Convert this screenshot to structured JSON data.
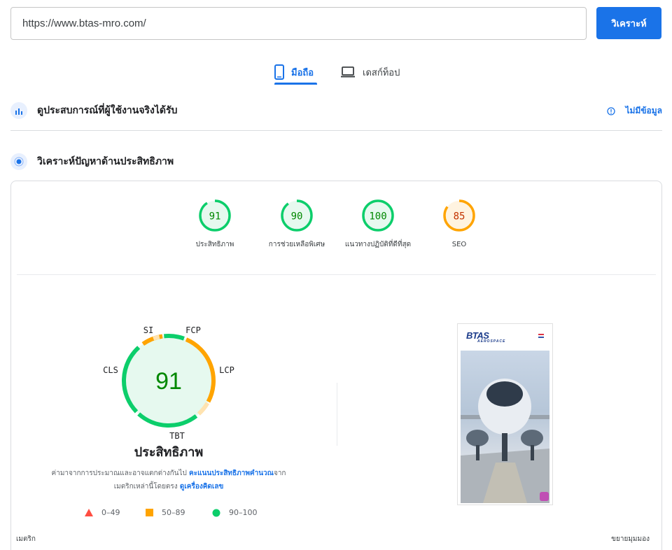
{
  "search": {
    "url": "https://www.btas-mro.com/",
    "button_label": "วิเคราะห์"
  },
  "tabs": [
    {
      "label": "มือถือ",
      "active": true
    },
    {
      "label": "เดสก์ท็อป",
      "active": false
    }
  ],
  "field_data": {
    "title": "ดูประสบการณ์ที่ผู้ใช้งานจริงได้รับ",
    "status_label": "ไม่มีข้อมูล"
  },
  "lab_data": {
    "title": "วิเคราะห์ปัญหาด้านประสิทธิภาพ"
  },
  "scores": [
    {
      "label": "ประสิทธิภาพ",
      "value": "91",
      "color": "#0cce6b",
      "text_color": "#008800"
    },
    {
      "label": "การช่วยเหลือพิเศษ",
      "value": "90",
      "color": "#0cce6b",
      "text_color": "#008800"
    },
    {
      "label": "แนวทางปฏิบัติที่ดีที่สุด",
      "value": "100",
      "color": "#0cce6b",
      "text_color": "#008800"
    },
    {
      "label": "SEO",
      "value": "85",
      "color": "#ffa400",
      "text_color": "#c33300"
    }
  ],
  "performance": {
    "score": "91",
    "title": "ประสิทธิภาพ",
    "metric_labels": {
      "si": "SI",
      "fcp": "FCP",
      "lcp": "LCP",
      "tbt": "TBT",
      "cls": "CLS"
    },
    "note_text": "ค่ามาจากการประมาณและอาจแตกต่างกันไป",
    "note_link1": "คะแนนประสิทธิภาพคำนวณ",
    "note_text2": "จาก",
    "note_text3": "เมตริกเหล่านี้โดยตรง",
    "note_link2": "ดูเครื่องคิดเลข"
  },
  "legend": [
    {
      "label": "0–49",
      "color": "#ff4e42"
    },
    {
      "label": "50–89",
      "color": "#ffa400"
    },
    {
      "label": "90–100",
      "color": "#0cce6b"
    }
  ],
  "screenshot": {
    "logo_text": "BTAS",
    "logo_sub": "AEROSPACE"
  },
  "footer": {
    "metrics_label": "เมตริก",
    "expand_label": "ขยายมุมมอง"
  }
}
